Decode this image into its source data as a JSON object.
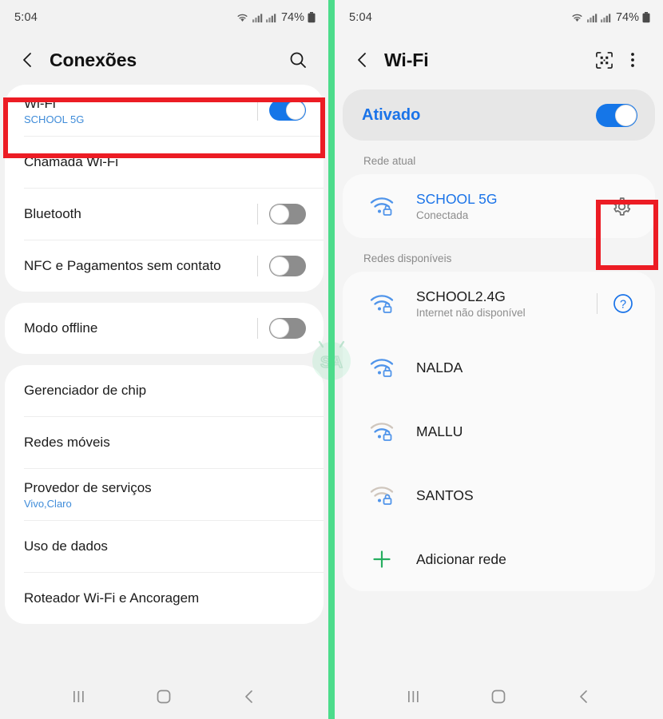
{
  "left_phone": {
    "status_bar": {
      "time": "5:04",
      "battery_percent": "74%",
      "icons": [
        "wifi-icon",
        "signal-icon",
        "signal-icon",
        "battery-icon"
      ]
    },
    "app_bar": {
      "back": "back-arrow",
      "title": "Conexões",
      "search": "search-icon"
    },
    "groups": [
      {
        "rows": [
          {
            "label": "Wi-Fi",
            "sub": "SCHOOL 5G",
            "toggle": "on",
            "highlighted": true
          },
          {
            "label": "Chamada Wi-Fi",
            "sub": "",
            "toggle": "none"
          },
          {
            "label": "Bluetooth",
            "sub": "",
            "toggle": "off"
          },
          {
            "label": "NFC e Pagamentos sem contato",
            "sub": "",
            "toggle": "off"
          }
        ]
      },
      {
        "rows": [
          {
            "label": "Modo offline",
            "sub": "",
            "toggle": "off"
          }
        ]
      },
      {
        "rows": [
          {
            "label": "Gerenciador de chip",
            "sub": "",
            "toggle": "none"
          },
          {
            "label": "Redes móveis",
            "sub": "",
            "toggle": "none"
          },
          {
            "label": "Provedor de serviços",
            "sub": "Vivo,Claro",
            "toggle": "none"
          },
          {
            "label": "Uso de dados",
            "sub": "",
            "toggle": "none"
          },
          {
            "label": "Roteador Wi-Fi e Ancoragem",
            "sub": "",
            "toggle": "none"
          }
        ]
      }
    ],
    "nav_bar": {
      "recents": "recents-icon",
      "home": "home-icon",
      "back": "back-icon"
    }
  },
  "right_phone": {
    "status_bar": {
      "time": "5:04",
      "battery_percent": "74%",
      "icons": [
        "wifi-icon",
        "signal-icon",
        "signal-icon",
        "battery-icon"
      ]
    },
    "app_bar": {
      "back": "back-arrow",
      "title": "Wi-Fi",
      "qr": "qr-scan-icon",
      "more": "more-vert-icon"
    },
    "wifi_toggle": {
      "label": "Ativado",
      "state": "on"
    },
    "current_network_title": "Rede atual",
    "current_network": {
      "name": "SCHOOL 5G",
      "state": "Conectada",
      "icon": "wifi-lock-icon",
      "signal": 3,
      "action": "gear-icon",
      "highlighted": true
    },
    "available_title": "Redes disponíveis",
    "available_networks": [
      {
        "name": "SCHOOL2.4G",
        "state": "Internet não disponível",
        "icon": "wifi-lock-icon",
        "signal": 3,
        "action": "help-icon"
      },
      {
        "name": "NALDA",
        "state": "",
        "icon": "wifi-lock-icon",
        "signal": 3,
        "action": "none"
      },
      {
        "name": "MALLU",
        "state": "",
        "icon": "wifi-lock-icon",
        "signal": 2,
        "action": "none"
      },
      {
        "name": "SANTOS",
        "state": "",
        "icon": "wifi-lock-icon",
        "signal": 1,
        "action": "none"
      }
    ],
    "add_network": {
      "label": "Adicionar rede",
      "icon": "plus-icon"
    },
    "nav_bar": {
      "recents": "recents-icon",
      "home": "home-icon",
      "back": "back-icon"
    }
  },
  "annotations": {
    "seam_color": "#4cdc8b",
    "callout_color": "#ec1c24",
    "accent_blue": "#1a73e8",
    "toggle_on_color": "#1576e8",
    "toggle_off_color": "#8d8d8d"
  }
}
